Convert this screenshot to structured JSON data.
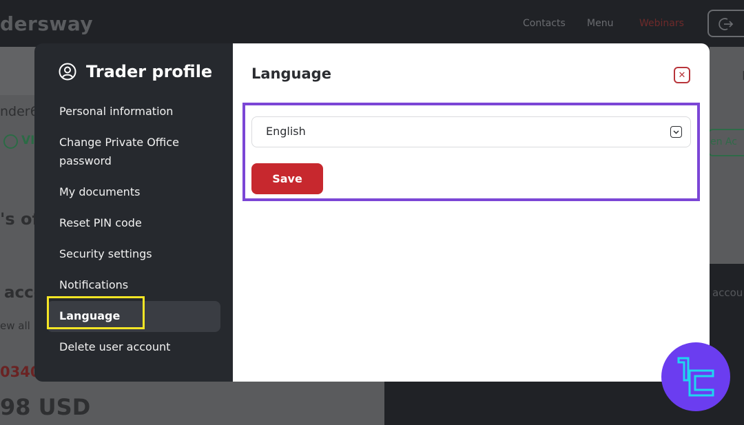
{
  "background": {
    "brand": "dersway",
    "nav": [
      "Contacts",
      "Menu",
      "Webinars"
    ],
    "user_fragment": "nder6",
    "verified_fragment": "VI",
    "offers_fragment": "'s of",
    "accounts_fragment": "acco",
    "view_all_fragment": "ew all",
    "account_number_fragment": "0340",
    "balance_fragment": "98 USD",
    "right_fragment_1": "I",
    "open_account_fragment": "en Ac",
    "right_fragment_2": "o accou"
  },
  "sidebar": {
    "title": "Trader profile",
    "title_icon": "user-circle-icon",
    "items": [
      {
        "label": "Personal information"
      },
      {
        "label": "Change Private Office password"
      },
      {
        "label": "My documents"
      },
      {
        "label": "Reset PIN code"
      },
      {
        "label": "Security settings"
      },
      {
        "label": "Notifications"
      },
      {
        "label": "Language",
        "active": true
      },
      {
        "label": "Delete user account"
      }
    ]
  },
  "main": {
    "title": "Language",
    "close_icon": "close-icon",
    "language_select": {
      "value": "English",
      "icon": "chevron-down-icon"
    },
    "save_label": "Save"
  },
  "colors": {
    "accent_red": "#c7282e",
    "highlight_yellow": "#f5e625",
    "highlight_purple": "#7b46d6",
    "sidebar_bg": "#26292e",
    "watermark_purple": "#6b3df0",
    "watermark_cyan": "#1fd6f0"
  },
  "watermark_icon": "tradingfinder-logo-icon"
}
